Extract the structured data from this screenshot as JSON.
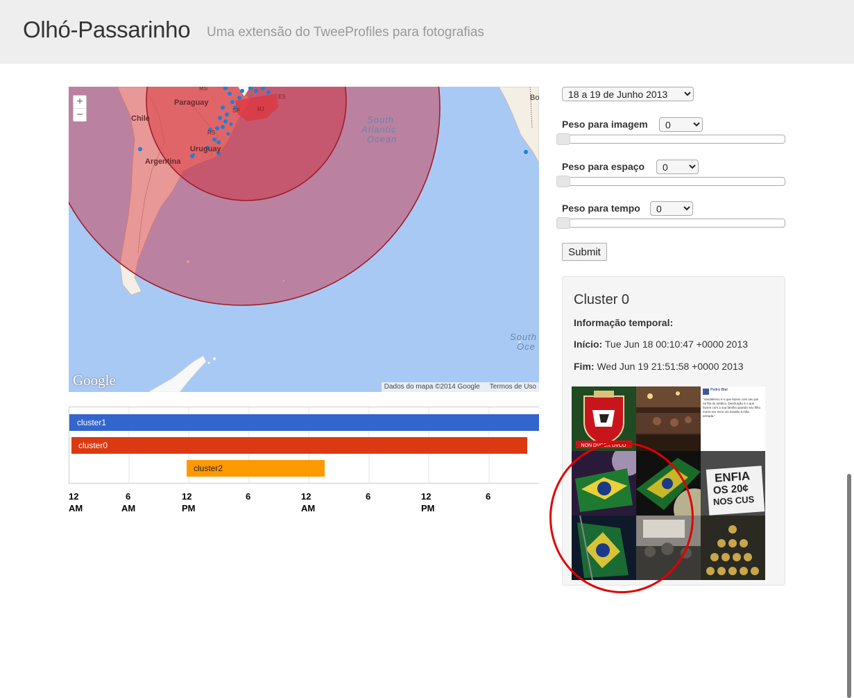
{
  "header": {
    "brand": "Olhó-Passarinho",
    "tagline": "Uma extensão do TweeProfiles para fotografias"
  },
  "map": {
    "zoom_in": "+",
    "zoom_out": "−",
    "labels": {
      "bo": "Bo",
      "chile": "Chile",
      "paraguay": "Paraguay",
      "ms": "MS",
      "es": "ES",
      "rj": "RJ",
      "sp": "SP",
      "rs": "RS",
      "uruguay": "Uruguay",
      "argentina": "Argentina",
      "ocean1": "South",
      "ocean2": "Atlantic",
      "ocean3": "Ocean",
      "south2a": "South",
      "south2b": "Oce"
    },
    "google_mark": "Google",
    "attribution": "Dados do mapa ©2014 Google",
    "terms": "Termos de Uso",
    "colors": {
      "water": "#a9c9f5",
      "land": "#f6f3ec",
      "cluster": "#d5202a",
      "point": "#1f7fd0"
    }
  },
  "timeline": {
    "bars": [
      {
        "name": "cluster1",
        "color": "#3366cc"
      },
      {
        "name": "cluster0",
        "color": "#dc3912"
      },
      {
        "name": "cluster2",
        "color": "#ff9900"
      }
    ],
    "ticks": [
      {
        "l1": "12",
        "l2": "AM"
      },
      {
        "l1": "6",
        "l2": "AM"
      },
      {
        "l1": "12",
        "l2": "PM"
      },
      {
        "l1": "6",
        "l2": ""
      },
      {
        "l1": "12",
        "l2": "AM"
      },
      {
        "l1": "6",
        "l2": ""
      },
      {
        "l1": "12",
        "l2": "PM"
      },
      {
        "l1": "6",
        "l2": ""
      }
    ]
  },
  "controls": {
    "date_value": "18 a 19 de Junho 2013",
    "image_weight_label": "Peso para imagem",
    "image_weight_value": "0",
    "space_weight_label": "Peso para espaço",
    "space_weight_value": "0",
    "time_weight_label": "Peso para tempo",
    "time_weight_value": "0",
    "submit_label": "Submit"
  },
  "cluster": {
    "title": "Cluster 0",
    "temporal_heading": "Informação temporal:",
    "start_label": "Início:",
    "start_value": "Tue Jun 18 00:10:47 +0000 2013",
    "end_label": "Fim:",
    "end_value": "Wed Jun 19 21:51:58 +0000 2013",
    "thumb_text": {
      "poster_name": "Pedro Bial",
      "post_snippet": "\"Vandalismo é o que fazem com seu pai na fila do médico. Destruição é o que fazem com a sua família quando seu filho morre em meio um assalto à mão armada.\"",
      "coat_banner": "NON DVCOR DVCO",
      "sign_line1": "ENFIA",
      "sign_line2": "OS 20¢",
      "sign_line3": "NOS CUS"
    }
  }
}
